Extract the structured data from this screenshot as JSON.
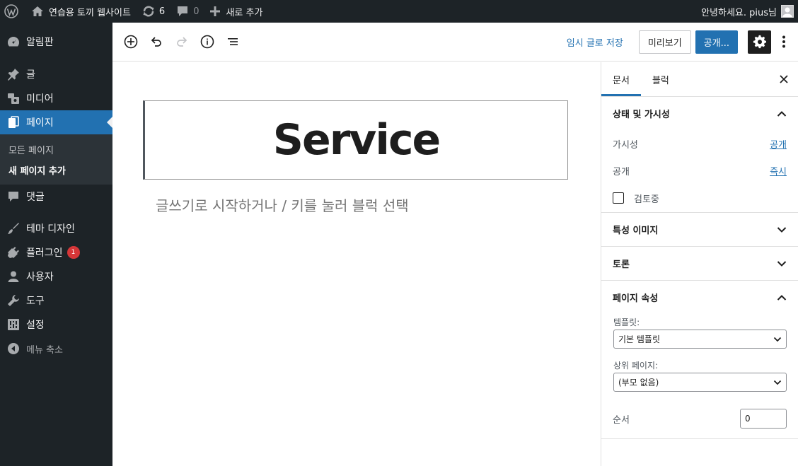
{
  "adminbar": {
    "site_name": "연습용 토끼 웹사이트",
    "updates_count": "6",
    "comments_count": "0",
    "new_label": "새로 추가",
    "greeting": "안녕하세요. pius님"
  },
  "sidebar": {
    "items": [
      {
        "label": "알림판",
        "icon": "dashboard-icon"
      },
      {
        "label": "글",
        "icon": "pin-icon"
      },
      {
        "label": "미디어",
        "icon": "media-icon"
      },
      {
        "label": "페이지",
        "icon": "pages-icon"
      },
      {
        "label": "댓글",
        "icon": "comment-icon"
      },
      {
        "label": "테마 디자인",
        "icon": "brush-icon"
      },
      {
        "label": "플러그인",
        "icon": "plugin-icon",
        "badge": "1"
      },
      {
        "label": "사용자",
        "icon": "user-icon"
      },
      {
        "label": "도구",
        "icon": "wrench-icon"
      },
      {
        "label": "설정",
        "icon": "settings-sliders-icon"
      }
    ],
    "submenu": [
      "모든 페이지",
      "새 페이지 추가"
    ],
    "collapse_label": "메뉴 축소"
  },
  "header": {
    "save_draft": "임시 글로 저장",
    "preview": "미리보기",
    "publish": "공개..."
  },
  "editor": {
    "title": "Service",
    "placeholder": "글쓰기로 시작하거나 / 키를 눌러 블럭 선택"
  },
  "panel": {
    "tabs": [
      "문서",
      "블럭"
    ],
    "status": {
      "title": "상태 및 가시성",
      "visibility_label": "가시성",
      "visibility_value": "공개",
      "publish_label": "공개",
      "publish_value": "즉시",
      "pending_label": "검토중"
    },
    "featured_image": "특성 이미지",
    "discussion": "토론",
    "page_attributes": {
      "title": "페이지 속성",
      "template_label": "템플릿:",
      "template_value": "기본 템플릿",
      "parent_label": "상위 페이지:",
      "parent_value": "(부모 없음)",
      "order_label": "순서",
      "order_value": "0"
    }
  },
  "colors": {
    "accent": "#2271b1",
    "admin_dark": "#1d2327",
    "badge": "#d63638"
  }
}
